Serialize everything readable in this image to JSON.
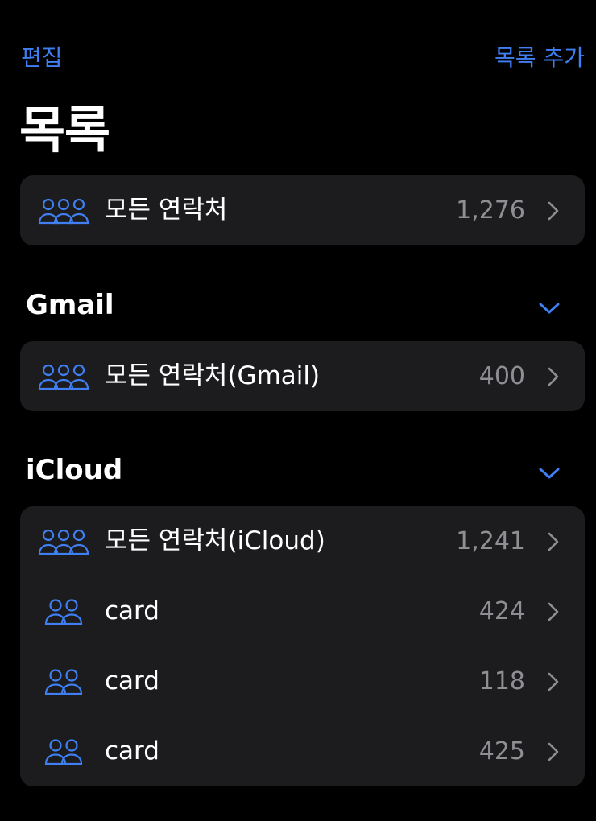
{
  "nav": {
    "edit_label": "편집",
    "add_list_label": "목록 추가"
  },
  "page_title": "목록",
  "all_contacts": {
    "label": "모든 연락처",
    "count": "1,276",
    "icon": "group-three-people-icon"
  },
  "sections": [
    {
      "title": "Gmail",
      "toggle_icon": "chevron-down-icon",
      "rows": [
        {
          "label": "모든 연락처(Gmail)",
          "count": "400",
          "icon": "group-three-people-icon"
        }
      ]
    },
    {
      "title": "iCloud",
      "toggle_icon": "chevron-down-icon",
      "rows": [
        {
          "label": "모든 연락처(iCloud)",
          "count": "1,241",
          "icon": "group-three-people-icon"
        },
        {
          "label": "card",
          "count": "424",
          "icon": "group-two-people-icon"
        },
        {
          "label": "card",
          "count": "118",
          "icon": "group-two-people-icon"
        },
        {
          "label": "card",
          "count": "425",
          "icon": "group-two-people-icon"
        }
      ]
    }
  ],
  "colors": {
    "accent": "#3f7ff2",
    "background": "#000000",
    "card": "#1c1c1e",
    "secondary_text": "#8e8e93",
    "separator": "#3a3a3c"
  }
}
